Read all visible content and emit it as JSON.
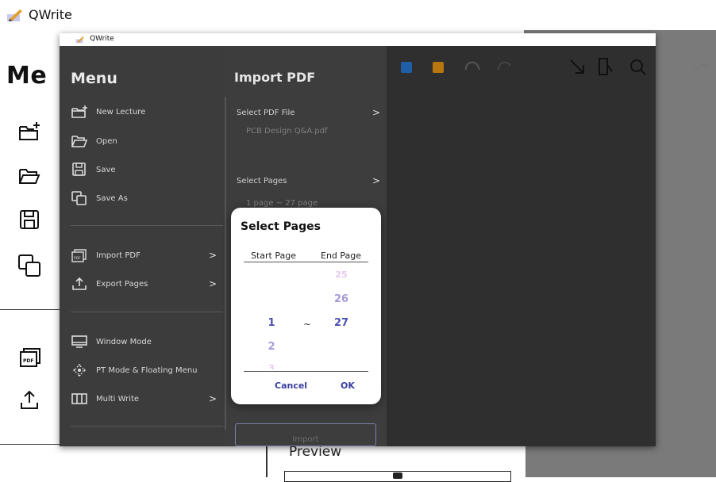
{
  "outer_window": {
    "title": "QWrite",
    "big_title": "Me",
    "preview_label": "Preview"
  },
  "inner_window": {
    "title": "QWrite"
  },
  "menu": {
    "title": "Menu",
    "groups": [
      [
        {
          "label": "New Lecture",
          "icon": "new-folder-icon"
        },
        {
          "label": "Open",
          "icon": "folder-open-icon"
        },
        {
          "label": "Save",
          "icon": "save-icon"
        },
        {
          "label": "Save As",
          "icon": "save-as-icon"
        }
      ],
      [
        {
          "label": "Import PDF",
          "icon": "pdf-icon",
          "arrow": ">"
        },
        {
          "label": "Export Pages",
          "icon": "export-icon",
          "arrow": ">"
        }
      ],
      [
        {
          "label": "Window Mode",
          "icon": "monitor-icon"
        },
        {
          "label": "PT Mode & Floating Menu",
          "icon": "move-icon"
        },
        {
          "label": "Multi Write",
          "icon": "columns-icon",
          "arrow": ">"
        }
      ]
    ]
  },
  "import_pdf": {
    "title": "Import PDF",
    "select_file_label": "Select PDF File",
    "file_name": "PCB Design Q&A.pdf",
    "select_pages_label": "Select Pages",
    "pages_value": "1 page ~ 27 page",
    "arrow": ">",
    "import_button": "Import"
  },
  "select_pages_dialog": {
    "title": "Select Pages",
    "start_header": "Start Page",
    "end_header": "End Page",
    "separator": "~",
    "start_values": [
      "1",
      "2",
      "3"
    ],
    "end_values": [
      "25",
      "26",
      "27"
    ],
    "cancel_label": "Cancel",
    "ok_label": "OK"
  },
  "toolbar": {
    "color_blue": "#1f5fa8",
    "color_orange": "#b8760f",
    "icons": [
      "undo-icon",
      "redo-icon",
      "arrow-icon",
      "select-icon",
      "search-icon"
    ]
  }
}
